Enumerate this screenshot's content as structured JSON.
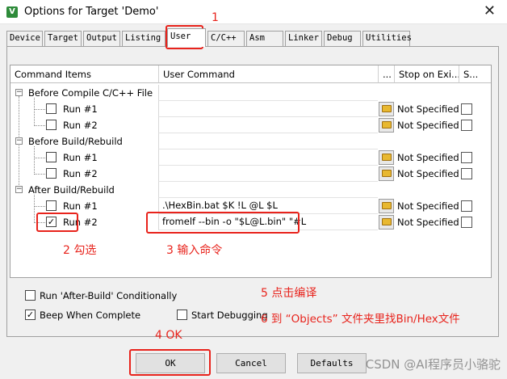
{
  "window": {
    "title": "Options for Target 'Demo'",
    "app_icon": "V"
  },
  "tabs": [
    "Device",
    "Target",
    "Output",
    "Listing",
    "User",
    "C/C++",
    "Asm",
    "Linker",
    "Debug",
    "Utilities"
  ],
  "table": {
    "headers": [
      "Command Items",
      "User Command",
      "...",
      "Stop on Exi...",
      "S..."
    ],
    "groups": [
      "Before Compile C/C++ File",
      "Before Build/Rebuild",
      "After Build/Rebuild"
    ],
    "run1": "Run #1",
    "run2": "Run #2",
    "stop_value": "Not Specified",
    "after_run1_cmd": ".\\HexBin.bat $K !L @L $L",
    "after_run2_cmd": "fromelf --bin -o \"$L@L.bin\" \"#L"
  },
  "options": {
    "run_after_build": "Run 'After-Build' Conditionally",
    "beep": "Beep When Complete",
    "start_debugging": "Start Debugging"
  },
  "buttons": {
    "ok": "OK",
    "cancel": "Cancel",
    "defaults": "Defaults"
  },
  "annotations": {
    "a1": "1",
    "a2": "2 勾选",
    "a3": "3 输入命令",
    "a4": "4 OK",
    "a5": "5 点击编译",
    "a6": "6 到 “Objects” 文件夹里找Bin/Hex文件"
  },
  "watermark": "CSDN @AI程序员小骆驼",
  "colors": {
    "annotation": "#e8231c",
    "folder": "#e8b830",
    "app_icon": "#2e8b3a"
  }
}
